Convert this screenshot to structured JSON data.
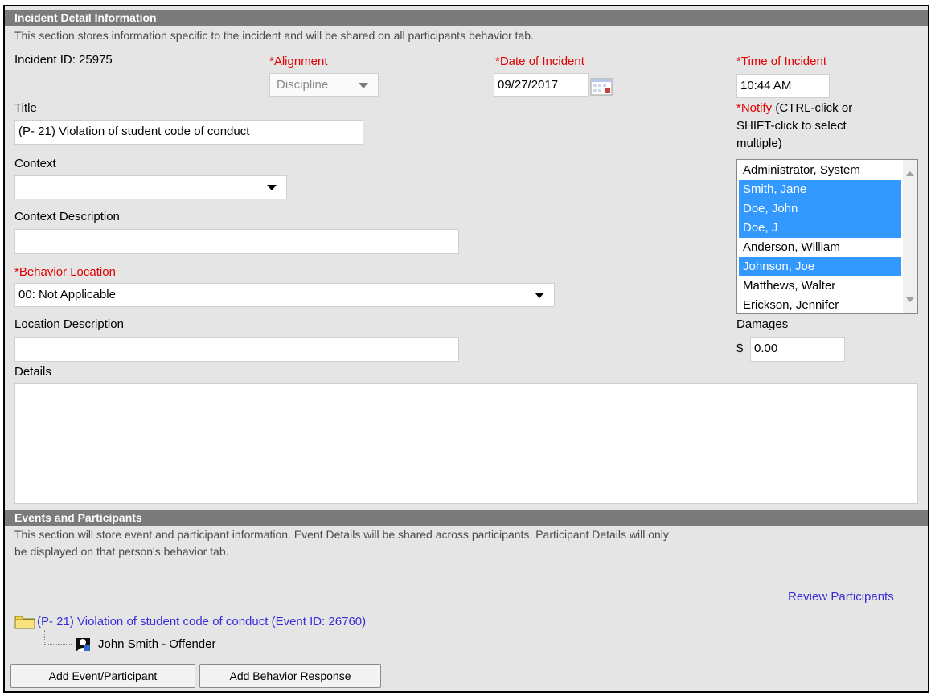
{
  "incident": {
    "header": "Incident Detail Information",
    "description": "This section stores information specific to the incident and will be shared on all participants behavior tab.",
    "incident_id_text": "Incident ID: 25975",
    "alignment": {
      "label": "*Alignment",
      "value": "Discipline"
    },
    "date": {
      "label": "*Date of Incident",
      "value": "09/27/2017"
    },
    "time": {
      "label": "*Time of Incident",
      "value": "10:44 AM"
    },
    "title": {
      "label": "Title",
      "value": "(P- 21) Violation of student code of conduct"
    },
    "notify": {
      "label_required": "*Notify",
      "label_hint_1": " (CTRL-click or",
      "label_hint_2": "SHIFT-click to select",
      "label_hint_3": "multiple)",
      "options": [
        {
          "name": "Administrator, System",
          "selected": false
        },
        {
          "name": "Smith, Jane",
          "selected": true
        },
        {
          "name": "Doe, John",
          "selected": true
        },
        {
          "name": "Doe, J",
          "selected": true
        },
        {
          "name": "Anderson, William",
          "selected": false
        },
        {
          "name": "Johnson, Joe",
          "selected": true
        },
        {
          "name": "Matthews, Walter",
          "selected": false
        },
        {
          "name": "Erickson, Jennifer",
          "selected": false
        }
      ]
    },
    "context": {
      "label": "Context",
      "value": ""
    },
    "context_description": {
      "label": "Context Description",
      "value": ""
    },
    "behavior_location": {
      "label": "*Behavior Location",
      "value": "00: Not Applicable"
    },
    "location_description": {
      "label": "Location Description",
      "value": ""
    },
    "damages": {
      "label": "Damages",
      "currency": "$",
      "value": "0.00"
    },
    "details": {
      "label": "Details",
      "value": ""
    }
  },
  "events": {
    "header": "Events and Participants",
    "description_line1": "This section will store event and participant information. Event Details will be shared across participants. Participant Details will only",
    "description_line2": "be displayed on that person's behavior tab.",
    "review_link": "Review Participants",
    "event_link": "(P- 21) Violation of student code of conduct (Event ID: 26760)",
    "participant": "John Smith - Offender",
    "add_event_button": "Add Event/Participant",
    "add_response_button": "Add Behavior Response"
  },
  "colors": {
    "header_bg": "#7b7b7b",
    "panel_bg": "#e5e5e5",
    "required": "#e00000",
    "link": "#3a2fd6",
    "selection": "#3399ff"
  }
}
